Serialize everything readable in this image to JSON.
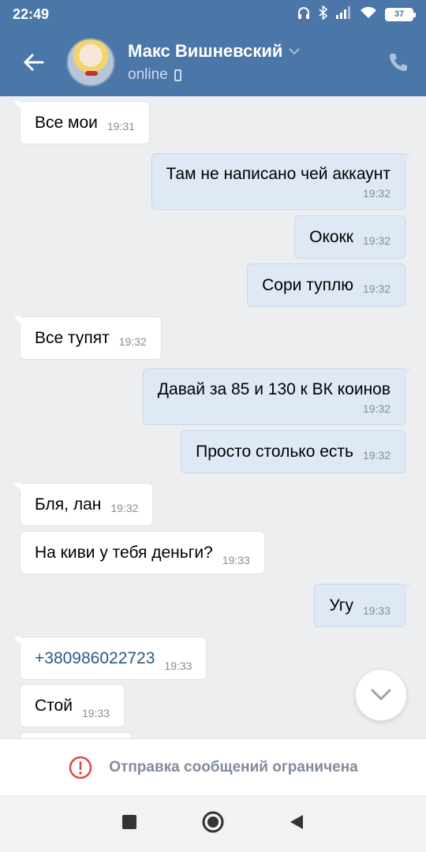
{
  "status_bar": {
    "time": "22:49",
    "icons": [
      "headphones-icon",
      "bluetooth-icon",
      "signal-icon",
      "wifi-icon"
    ],
    "battery": "37"
  },
  "header": {
    "contact_name": "Макс Вишневский",
    "status": "online",
    "colors": {
      "bar": "#4a76a8"
    }
  },
  "messages": [
    {
      "dir": "in",
      "text": "Все мои",
      "time": "19:31",
      "tail": true
    },
    {
      "dir": "out",
      "text": "Там не написано чей аккаунт",
      "time": "19:32",
      "tail": true
    },
    {
      "dir": "out",
      "text": "Ококк",
      "time": "19:32",
      "tail": false
    },
    {
      "dir": "out",
      "text": "Сори туплю",
      "time": "19:32",
      "tail": false
    },
    {
      "dir": "in",
      "text": "Все тупят",
      "time": "19:32",
      "tail": true
    },
    {
      "dir": "out",
      "text": "Давай за 85 и 130 к ВК коинов",
      "time": "19:32",
      "tail": true
    },
    {
      "dir": "out",
      "text": "Просто столько есть",
      "time": "19:32",
      "tail": false
    },
    {
      "dir": "in",
      "text": "Бля, лан",
      "time": "19:32",
      "tail": true
    },
    {
      "dir": "in",
      "text": "На киви у тебя деньги?",
      "time": "19:33",
      "tail": false
    },
    {
      "dir": "out",
      "text": "Угу",
      "time": "19:33",
      "tail": true
    },
    {
      "dir": "in",
      "text": "+380986022723",
      "time": "19:33",
      "tail": true,
      "link": true
    },
    {
      "dir": "in",
      "text": "Стой",
      "time": "19:33",
      "tail": false
    }
  ],
  "restriction": {
    "text": "Отправка сообщений ограничена",
    "icon": "alert-circle-icon",
    "icon_color": "#e64646"
  },
  "navbar": {
    "icons": [
      "recents-square-icon",
      "home-circle-icon",
      "back-triangle-icon"
    ]
  }
}
